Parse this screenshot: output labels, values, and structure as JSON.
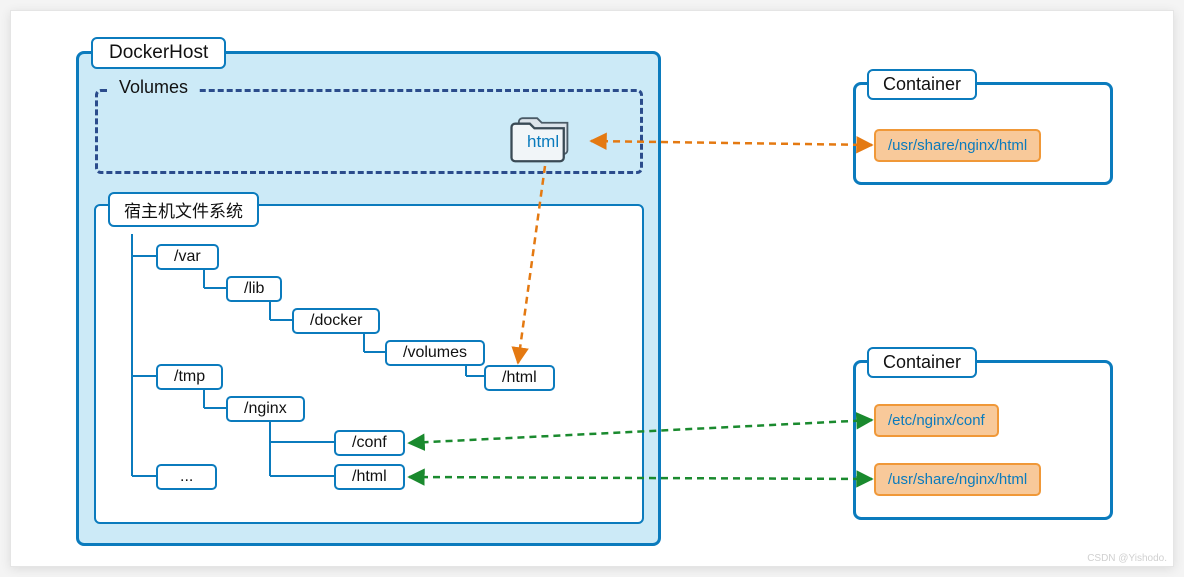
{
  "dockerHost": {
    "label": "DockerHost",
    "volumesLabel": "Volumes",
    "htmlFolderLabel": "html"
  },
  "filesystem": {
    "label": "宿主机文件系统",
    "nodes": {
      "var": "/var",
      "lib": "/lib",
      "docker": "/docker",
      "volumes": "/volumes",
      "html": "/html",
      "tmp": "/tmp",
      "nginx": "/nginx",
      "conf": "/conf",
      "html2": "/html",
      "ellipsis": "..."
    }
  },
  "containers": {
    "top": {
      "label": "Container",
      "paths": {
        "html": "/usr/share/nginx/html"
      }
    },
    "bottom": {
      "label": "Container",
      "paths": {
        "conf": "/etc/nginx/conf",
        "html": "/usr/share/nginx/html"
      }
    }
  },
  "watermark": "CSDN @Yishodo."
}
